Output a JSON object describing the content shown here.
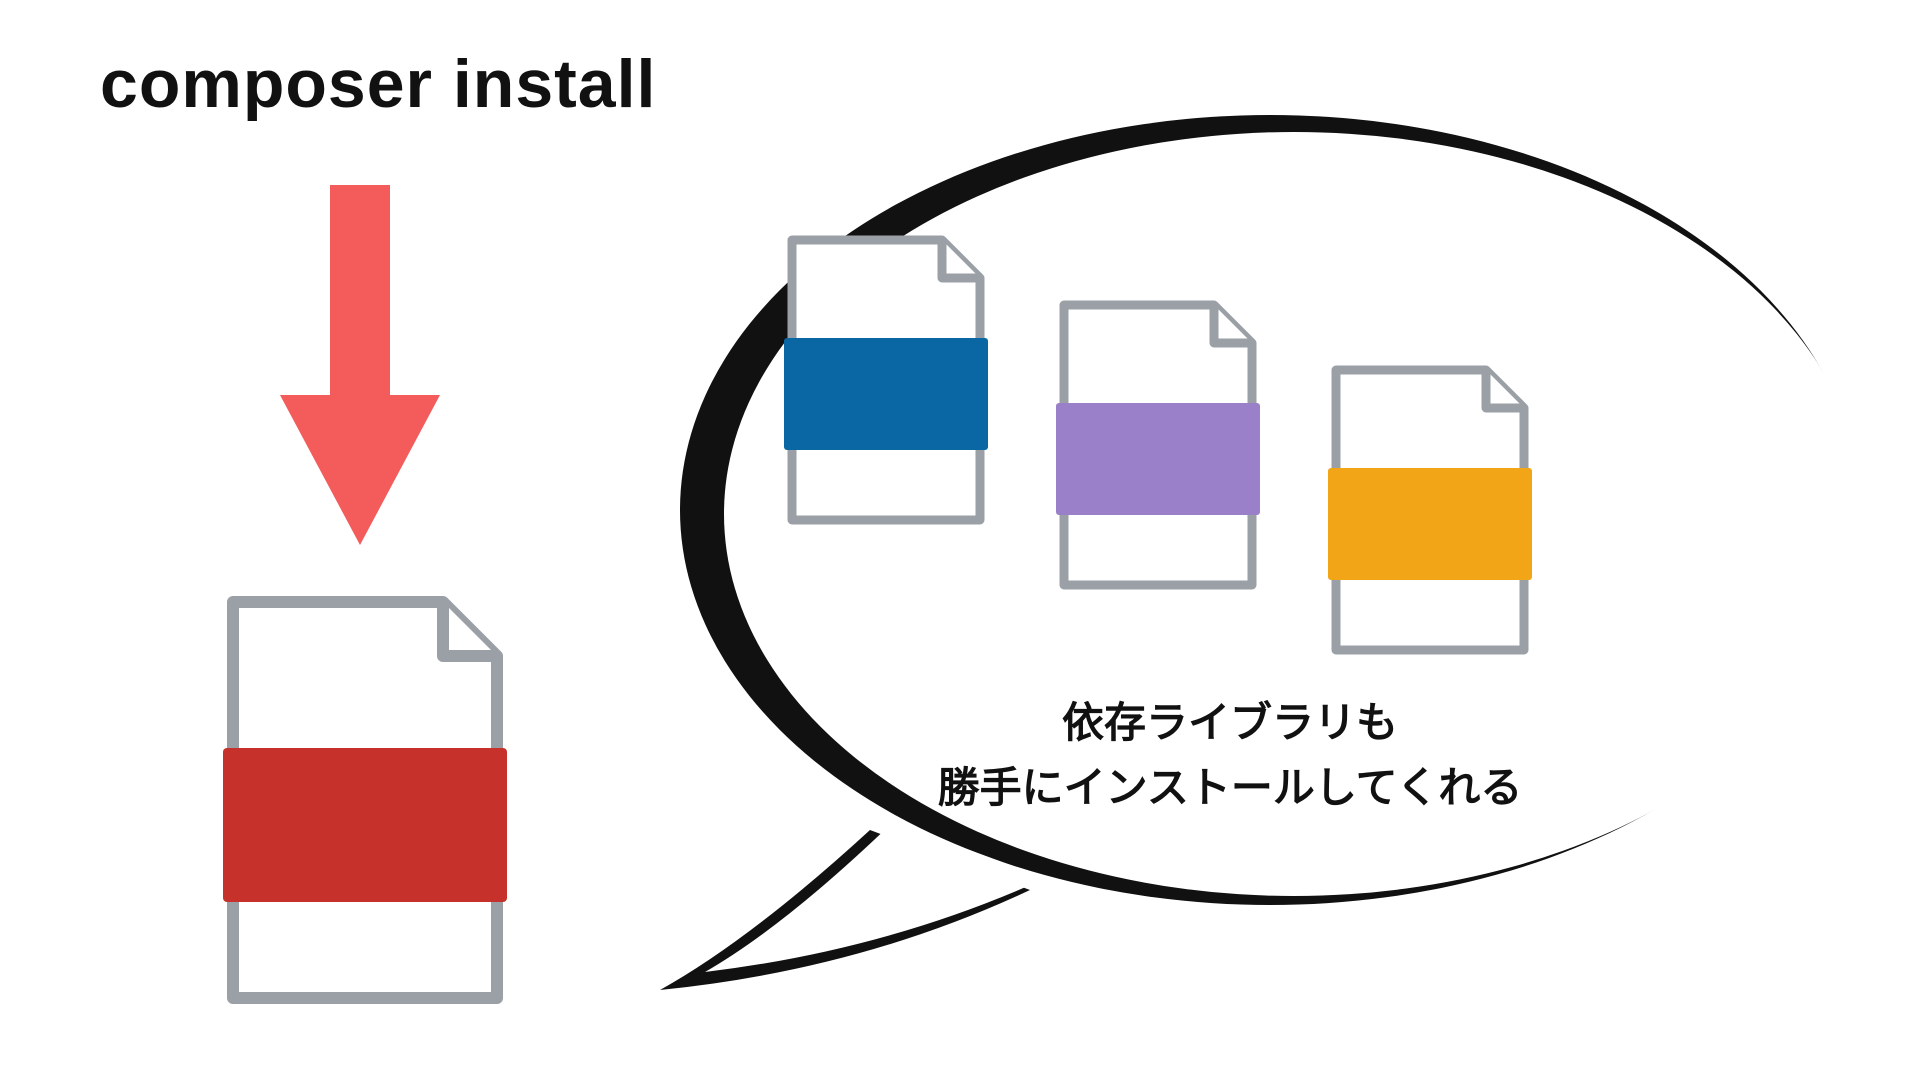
{
  "title": "composer install",
  "caption": "依存ライブラリも\n勝手にインストールしてくれる",
  "colors": {
    "arrow": "#f45b5b",
    "file_outline": "#9aa0a6",
    "file_red": "#c6322b",
    "file_blue": "#0a67a3",
    "file_purple": "#9a7fc9",
    "file_orange": "#f2a516",
    "bubble_stroke": "#111111"
  },
  "icons": {
    "arrow": "down-arrow-icon",
    "red_file": "file-red-icon",
    "blue_file": "file-blue-icon",
    "purple_file": "file-purple-icon",
    "orange_file": "file-orange-icon",
    "bubble": "speech-bubble-icon"
  }
}
